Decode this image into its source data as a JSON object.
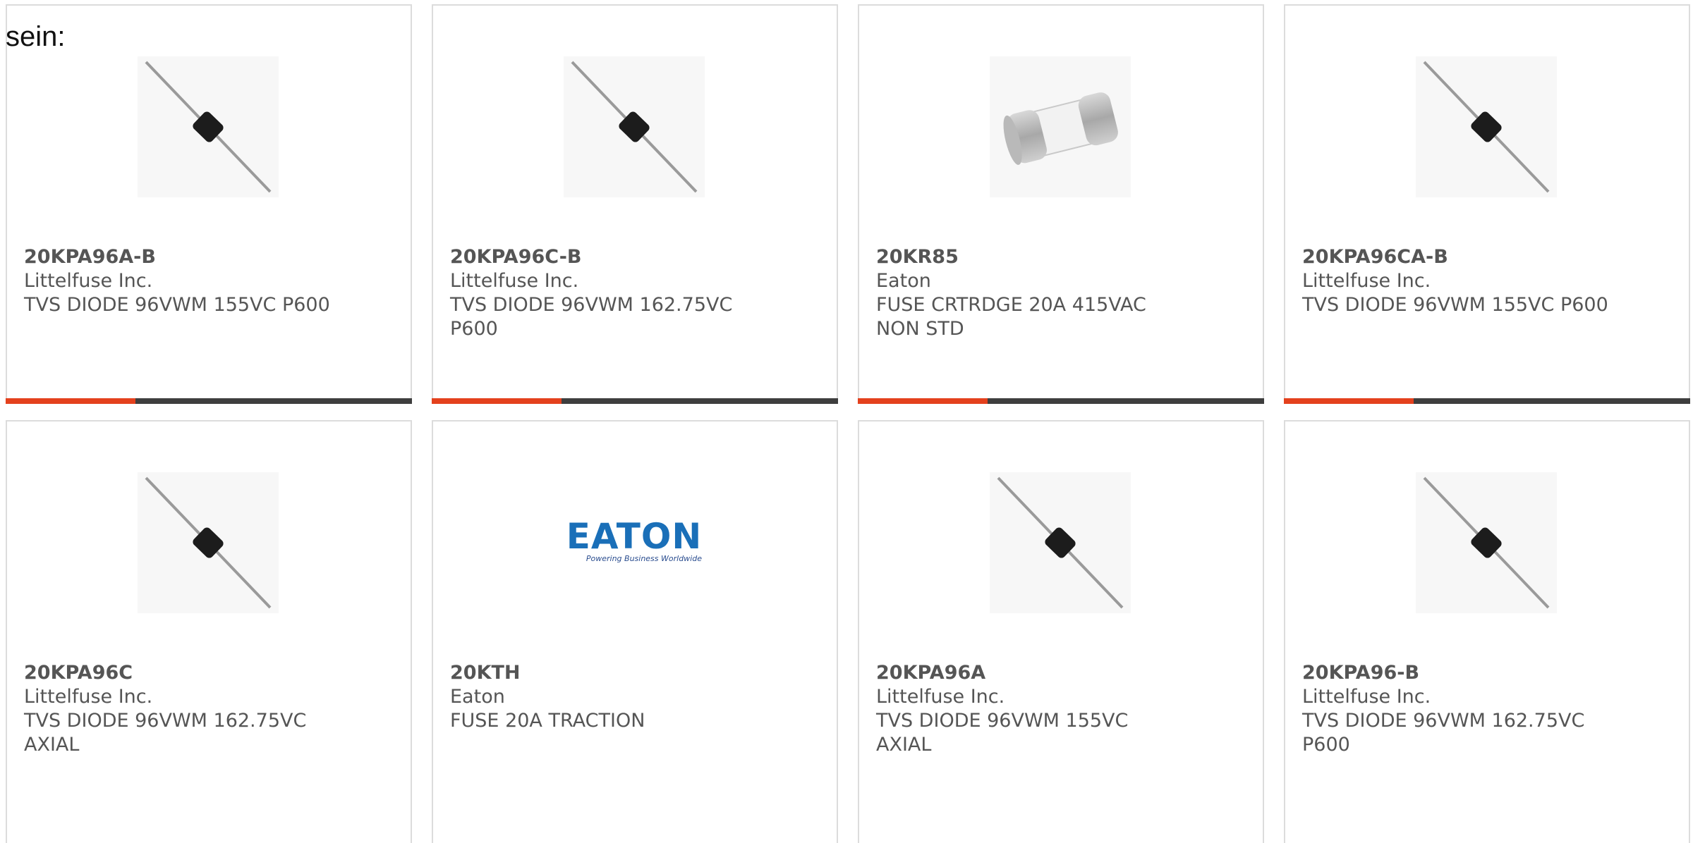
{
  "intro_text": "sein:",
  "products": [
    {
      "part": "20KPA96A-B",
      "manufacturer": "Littelfuse Inc.",
      "description": "TVS DIODE 96VWM 155VC P600",
      "image": "axial-diode-icon",
      "progress": 0.32
    },
    {
      "part": "20KPA96C-B",
      "manufacturer": "Littelfuse Inc.",
      "description": "TVS DIODE 96VWM 162.75VC P600",
      "image": "axial-diode-icon",
      "progress": 0.32
    },
    {
      "part": "20KR85",
      "manufacturer": "Eaton",
      "description": "FUSE CRTRDGE 20A 415VAC NON STD",
      "image": "cartridge-fuse-icon",
      "progress": 0.32
    },
    {
      "part": "20KPA96CA-B",
      "manufacturer": "Littelfuse Inc.",
      "description": "TVS DIODE 96VWM 155VC P600",
      "image": "axial-diode-icon",
      "progress": 0.32
    },
    {
      "part": "20KPA96C",
      "manufacturer": "Littelfuse Inc.",
      "description": "TVS DIODE 96VWM 162.75VC AXIAL",
      "image": "axial-diode-icon"
    },
    {
      "part": "20KTH",
      "manufacturer": "Eaton",
      "description": "FUSE 20A TRACTION",
      "image": "eaton-logo",
      "logo_text": "EATON",
      "logo_tagline": "Powering Business Worldwide"
    },
    {
      "part": "20KPA96A",
      "manufacturer": "Littelfuse Inc.",
      "description": "TVS DIODE 96VWM 155VC AXIAL",
      "image": "axial-diode-icon"
    },
    {
      "part": "20KPA96-B",
      "manufacturer": "Littelfuse Inc.",
      "description": "TVS DIODE 96VWM 162.75VC P600",
      "image": "axial-diode-icon"
    }
  ],
  "colors": {
    "accent": "#e4411d",
    "bar": "#3e3e3e",
    "text": "#555555",
    "eaton_blue": "#1a6fb8"
  }
}
